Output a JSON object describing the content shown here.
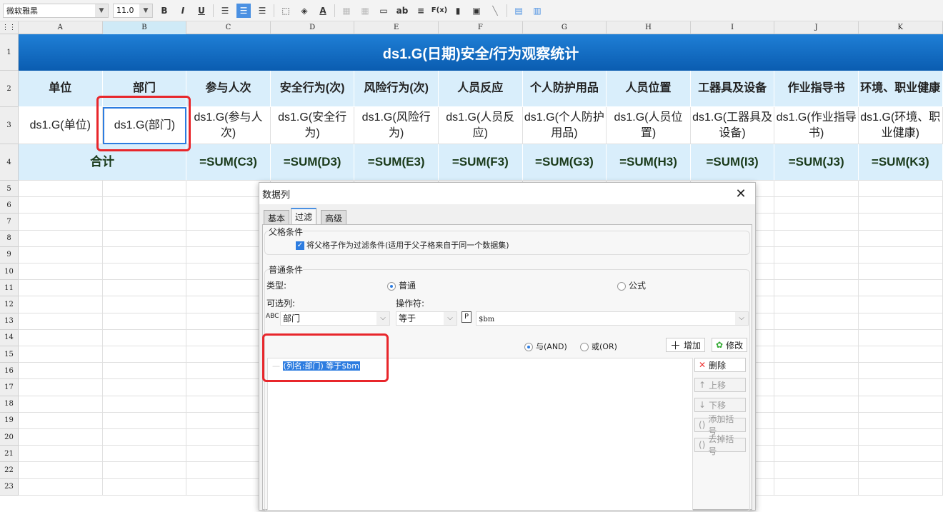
{
  "toolbar": {
    "font": "微软雅黑",
    "size": "11.0",
    "bold": "B",
    "italic": "I",
    "underline": "U",
    "font_color": "A",
    "text": "ab",
    "formula": "F(x)"
  },
  "columns": [
    "A",
    "B",
    "C",
    "D",
    "E",
    "F",
    "G",
    "H",
    "I",
    "J",
    "K"
  ],
  "rows": [
    "1",
    "2",
    "3",
    "4",
    "5",
    "6",
    "7",
    "8",
    "9",
    "10",
    "11",
    "12",
    "13",
    "14",
    "15",
    "16",
    "17",
    "18",
    "19",
    "20",
    "21",
    "22",
    "23"
  ],
  "sheet": {
    "title": "ds1.G(日期)安全/行为观察统计",
    "headers": [
      "单位",
      "部门",
      "参与人次",
      "安全行为(次)",
      "风险行为(次)",
      "人员反应",
      "个人防护用品",
      "人员位置",
      "工器具及设备",
      "作业指导书",
      "环境、职业健康"
    ],
    "data": [
      "ds1.G(单位)",
      "ds1.G(部门)",
      "ds1.G(参与人次)",
      "ds1.G(安全行为)",
      "ds1.G(风险行为)",
      "ds1.G(人员反应)",
      "ds1.G(个人防护用品)",
      "ds1.G(人员位置)",
      "ds1.G(工器具及设备)",
      "ds1.G(作业指导书)",
      "ds1.G(环境、职业健康)"
    ],
    "total_label": "合计",
    "sums": [
      "=SUM(C3)",
      "=SUM(D3)",
      "=SUM(E3)",
      "=SUM(F3)",
      "=SUM(G3)",
      "=SUM(H3)",
      "=SUM(I3)",
      "=SUM(J3)",
      "=SUM(K3)"
    ]
  },
  "dialog": {
    "title": "数据列",
    "tabs": [
      "基本",
      "过滤",
      "高级"
    ],
    "parent_group": "父格条件",
    "parent_checkbox": "将父格子作为过滤条件(适用于父子格来自于同一个数据集)",
    "parent_checked": true,
    "normal_group": "普通条件",
    "type_label": "类型:",
    "type_normal": "普通",
    "type_formula": "公式",
    "column_label": "可选列:",
    "operator_label": "操作符:",
    "column_value": "部门",
    "operator_value": "等于",
    "param_icon": "P",
    "value": "$bm",
    "and": "与(AND)",
    "or": "或(OR)",
    "add": "增加",
    "modify": "修改",
    "delete": "删除",
    "up": "上移",
    "down": "下移",
    "add_bracket": "添加括号",
    "remove_bracket": "去掉括号",
    "condition": "(列名:部门) 等于$bm"
  },
  "colors": {
    "title_bg": "#0a5cb0",
    "header_bg": "#d9eefb",
    "highlight": "#e8262b",
    "accent": "#2d7ce0"
  }
}
